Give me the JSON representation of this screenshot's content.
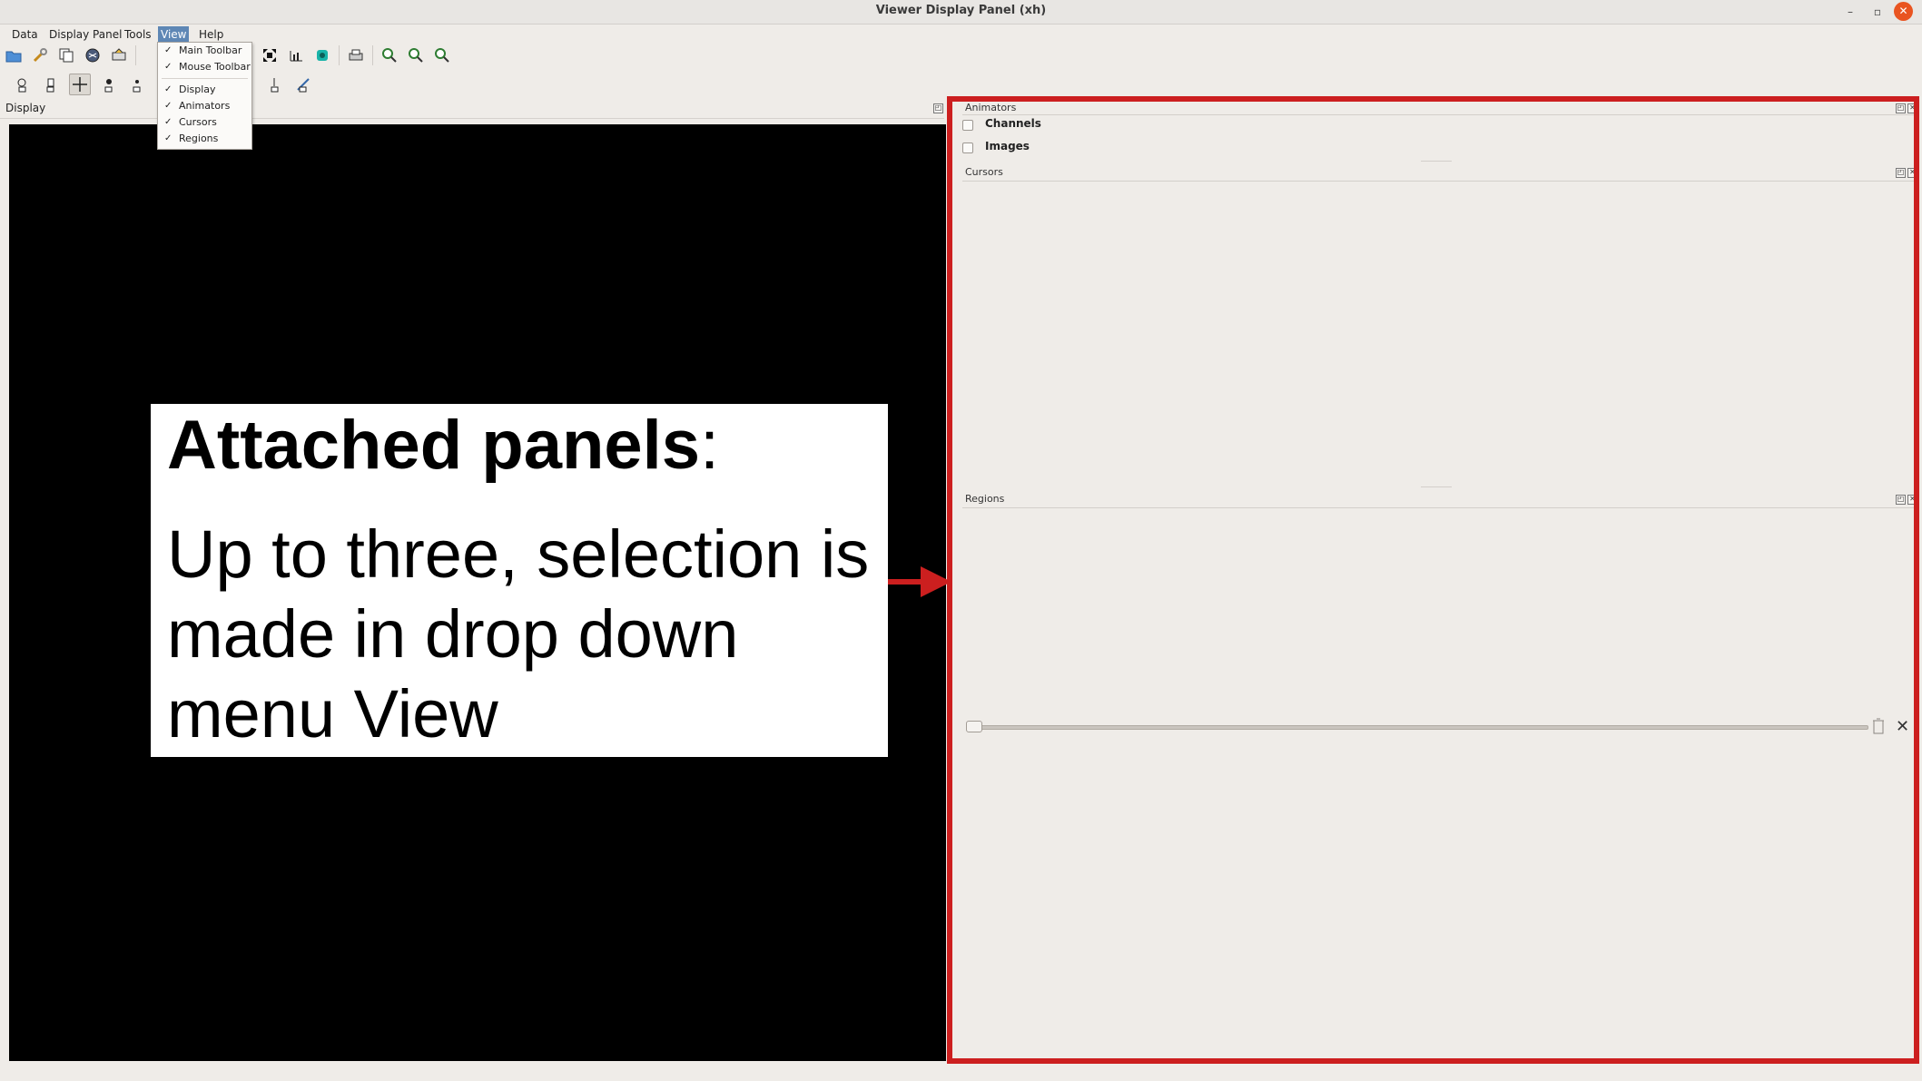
{
  "window": {
    "title": "Viewer Display Panel (xh)",
    "minimize_glyph": "–",
    "restore_glyph": "▫",
    "close_glyph": "✕"
  },
  "menubar": {
    "data": "Data",
    "display_panel": "Display Panel",
    "tools": "Tools",
    "view": "View",
    "help": "Help"
  },
  "view_menu": {
    "items": [
      {
        "label": "Main Toolbar",
        "checked": true
      },
      {
        "label": "Mouse Toolbar",
        "checked": true
      },
      {
        "label": "Display",
        "checked": true
      },
      {
        "label": "Animators",
        "checked": true
      },
      {
        "label": "Cursors",
        "checked": true
      },
      {
        "label": "Regions",
        "checked": true
      }
    ],
    "check_glyph": "✓"
  },
  "display": {
    "label": "Display"
  },
  "callout": {
    "title_bold": "Attached panels",
    "title_suffix": ":",
    "body": "Up to three, selection is made in drop down menu View"
  },
  "panels": {
    "animators": {
      "title": "Animators",
      "channels": "Channels",
      "images": "Images"
    },
    "cursors": {
      "title": "Cursors"
    },
    "regions": {
      "title": "Regions"
    }
  },
  "colors": {
    "highlight": "#cc1f1f",
    "menu_active": "#5e87b5",
    "close_button": "#e95420"
  }
}
